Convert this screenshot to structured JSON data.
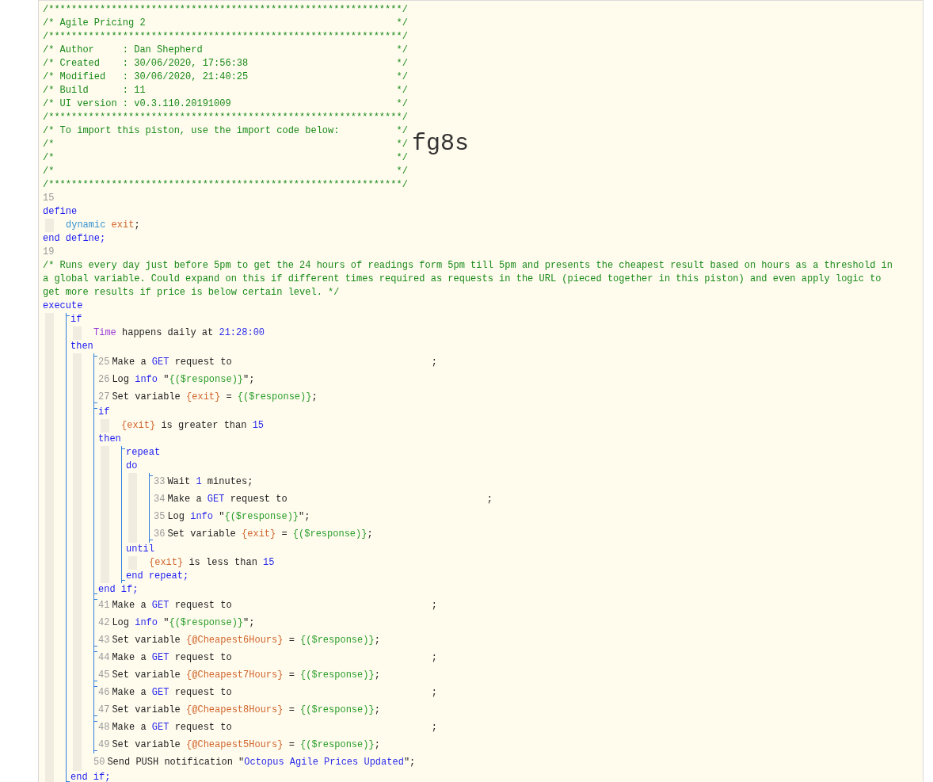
{
  "header": [
    {
      "text": "/**************************************************************/"
    },
    {
      "text": "/* Agile Pricing 2",
      "close": "*/"
    },
    {
      "text": "/**************************************************************/"
    },
    {
      "text": "/* Author     : Dan Shepherd",
      "close": "*/"
    },
    {
      "text": "/* Created    : 30/06/2020, 17:56:38",
      "close": "*/"
    },
    {
      "text": "/* Modified   : 30/06/2020, 21:40:25",
      "close": "*/"
    },
    {
      "text": "/* Build      : 11",
      "close": "*/"
    },
    {
      "text": "/* UI version : v0.3.110.20191009",
      "close": "*/"
    },
    {
      "text": "/**************************************************************/"
    },
    {
      "text": "/* To import this piston, use the import code below:",
      "close": "*/"
    },
    {
      "text": "/*",
      "close": "*/",
      "import_code": "fg8s"
    },
    {
      "text": "/*",
      "close": "*/"
    },
    {
      "text": "/*",
      "close": "*/"
    },
    {
      "text": "/**************************************************************/"
    }
  ],
  "code": [
    {
      "kind": "line",
      "number": "15"
    },
    {
      "kind": "line",
      "tokens": [
        {
          "text": "define",
          "kind": "keyword"
        }
      ]
    },
    {
      "kind": "indent",
      "children": [
        {
          "kind": "line",
          "tokens": [
            {
              "text": "dynamic ",
              "kind": "type"
            },
            {
              "text": "exit",
              "kind": "variable"
            },
            {
              "text": ";",
              "kind": "plain"
            }
          ]
        }
      ]
    },
    {
      "kind": "line",
      "tokens": [
        {
          "text": "end define;",
          "kind": "keyword"
        }
      ]
    },
    {
      "kind": "line",
      "number": "19"
    },
    {
      "kind": "comment",
      "text": "/* Runs every day just before 5pm to get the 24 hours of readings form 5pm till 5pm and presents the cheapest result based on hours as a threshold in a global variable. Could expand on this if different times required as requests in the URL (pieced together in this piston) and even apply logic to get more results if price is below certain level. */"
    },
    {
      "kind": "line",
      "tokens": [
        {
          "text": "execute",
          "kind": "keyword"
        }
      ]
    },
    {
      "kind": "indent",
      "children": [
        {
          "kind": "bracket",
          "children": [
            {
              "kind": "line",
              "tokens": [
                {
                  "text": "if",
                  "kind": "keyword"
                }
              ]
            },
            {
              "kind": "indent",
              "children": [
                {
                  "kind": "line",
                  "tokens": [
                    {
                      "text": "Time",
                      "kind": "device"
                    },
                    {
                      "text": " happens daily at ",
                      "kind": "plain"
                    },
                    {
                      "text": "21:28:00",
                      "kind": "value"
                    }
                  ]
                }
              ]
            },
            {
              "kind": "line",
              "tokens": [
                {
                  "text": "then",
                  "kind": "keyword"
                }
              ]
            },
            {
              "kind": "indent",
              "children": [
                {
                  "kind": "bracket",
                  "children": [
                    {
                      "kind": "line",
                      "number": "25",
                      "tokens": [
                        {
                          "text": "Make a ",
                          "kind": "plain"
                        },
                        {
                          "text": "GET",
                          "kind": "value"
                        },
                        {
                          "text": " request to",
                          "kind": "plain"
                        },
                        {
                          "text": ";",
                          "kind": "terminator"
                        }
                      ]
                    },
                    {
                      "kind": "line",
                      "number": "26",
                      "tokens": [
                        {
                          "text": "Log ",
                          "kind": "plain"
                        },
                        {
                          "text": "info",
                          "kind": "value"
                        },
                        {
                          "text": " \"",
                          "kind": "plain"
                        },
                        {
                          "text": "{($response)}",
                          "kind": "string"
                        },
                        {
                          "text": "\";",
                          "kind": "plain"
                        }
                      ]
                    },
                    {
                      "kind": "line",
                      "number": "27",
                      "tokens": [
                        {
                          "text": "Set variable ",
                          "kind": "plain"
                        },
                        {
                          "text": "{exit}",
                          "kind": "variable"
                        },
                        {
                          "text": " = ",
                          "kind": "plain"
                        },
                        {
                          "text": "{($response)}",
                          "kind": "string"
                        },
                        {
                          "text": ";",
                          "kind": "plain"
                        }
                      ]
                    }
                  ]
                },
                {
                  "kind": "bracket",
                  "children": [
                    {
                      "kind": "line",
                      "tokens": [
                        {
                          "text": "if",
                          "kind": "keyword"
                        }
                      ]
                    },
                    {
                      "kind": "indent",
                      "children": [
                        {
                          "kind": "line",
                          "tokens": [
                            {
                              "text": "{exit}",
                              "kind": "variable"
                            },
                            {
                              "text": " is greater than ",
                              "kind": "plain"
                            },
                            {
                              "text": "15",
                              "kind": "value"
                            }
                          ]
                        }
                      ]
                    },
                    {
                      "kind": "line",
                      "tokens": [
                        {
                          "text": "then",
                          "kind": "keyword"
                        }
                      ]
                    },
                    {
                      "kind": "indent",
                      "children": [
                        {
                          "kind": "bracket",
                          "children": [
                            {
                              "kind": "line",
                              "tokens": [
                                {
                                  "text": "repeat",
                                  "kind": "keyword"
                                }
                              ]
                            },
                            {
                              "kind": "line",
                              "tokens": [
                                {
                                  "text": "do",
                                  "kind": "keyword"
                                }
                              ]
                            },
                            {
                              "kind": "indent",
                              "children": [
                                {
                                  "kind": "bracket",
                                  "children": [
                                    {
                                      "kind": "line",
                                      "number": "33",
                                      "tokens": [
                                        {
                                          "text": "Wait ",
                                          "kind": "plain"
                                        },
                                        {
                                          "text": "1",
                                          "kind": "value"
                                        },
                                        {
                                          "text": " minutes;",
                                          "kind": "plain"
                                        }
                                      ]
                                    },
                                    {
                                      "kind": "line",
                                      "number": "34",
                                      "tokens": [
                                        {
                                          "text": "Make a ",
                                          "kind": "plain"
                                        },
                                        {
                                          "text": "GET",
                                          "kind": "value"
                                        },
                                        {
                                          "text": " request to",
                                          "kind": "plain"
                                        },
                                        {
                                          "text": ";",
                                          "kind": "terminator"
                                        }
                                      ]
                                    },
                                    {
                                      "kind": "line",
                                      "number": "35",
                                      "tokens": [
                                        {
                                          "text": "Log ",
                                          "kind": "plain"
                                        },
                                        {
                                          "text": "info",
                                          "kind": "value"
                                        },
                                        {
                                          "text": " \"",
                                          "kind": "plain"
                                        },
                                        {
                                          "text": "{($response)}",
                                          "kind": "string"
                                        },
                                        {
                                          "text": "\";",
                                          "kind": "plain"
                                        }
                                      ]
                                    },
                                    {
                                      "kind": "line",
                                      "number": "36",
                                      "tokens": [
                                        {
                                          "text": "Set variable ",
                                          "kind": "plain"
                                        },
                                        {
                                          "text": "{exit}",
                                          "kind": "variable"
                                        },
                                        {
                                          "text": " = ",
                                          "kind": "plain"
                                        },
                                        {
                                          "text": "{($response)}",
                                          "kind": "string"
                                        },
                                        {
                                          "text": ";",
                                          "kind": "plain"
                                        }
                                      ]
                                    }
                                  ]
                                }
                              ]
                            },
                            {
                              "kind": "line",
                              "tokens": [
                                {
                                  "text": "until",
                                  "kind": "keyword"
                                }
                              ]
                            },
                            {
                              "kind": "indent",
                              "children": [
                                {
                                  "kind": "line",
                                  "tokens": [
                                    {
                                      "text": "{exit}",
                                      "kind": "variable"
                                    },
                                    {
                                      "text": " is less than ",
                                      "kind": "plain"
                                    },
                                    {
                                      "text": "15",
                                      "kind": "value"
                                    }
                                  ]
                                }
                              ]
                            },
                            {
                              "kind": "line",
                              "tokens": [
                                {
                                  "text": "end repeat;",
                                  "kind": "keyword"
                                }
                              ]
                            }
                          ]
                        }
                      ]
                    },
                    {
                      "kind": "line",
                      "tokens": [
                        {
                          "text": "end if;",
                          "kind": "keyword"
                        }
                      ]
                    }
                  ]
                },
                {
                  "kind": "bracket",
                  "children": [
                    {
                      "kind": "line",
                      "number": "41",
                      "tokens": [
                        {
                          "text": "Make a ",
                          "kind": "plain"
                        },
                        {
                          "text": "GET",
                          "kind": "value"
                        },
                        {
                          "text": " request to",
                          "kind": "plain"
                        },
                        {
                          "text": ";",
                          "kind": "terminator"
                        }
                      ]
                    },
                    {
                      "kind": "line",
                      "number": "42",
                      "tokens": [
                        {
                          "text": "Log ",
                          "kind": "plain"
                        },
                        {
                          "text": "info",
                          "kind": "value"
                        },
                        {
                          "text": " \"",
                          "kind": "plain"
                        },
                        {
                          "text": "{($response)}",
                          "kind": "string"
                        },
                        {
                          "text": "\";",
                          "kind": "plain"
                        }
                      ]
                    },
                    {
                      "kind": "line",
                      "number": "43",
                      "tokens": [
                        {
                          "text": "Set variable ",
                          "kind": "plain"
                        },
                        {
                          "text": "{@Cheapest6Hours}",
                          "kind": "variable"
                        },
                        {
                          "text": " = ",
                          "kind": "plain"
                        },
                        {
                          "text": "{($response)}",
                          "kind": "string"
                        },
                        {
                          "text": ";",
                          "kind": "plain"
                        }
                      ]
                    }
                  ]
                },
                {
                  "kind": "bracket",
                  "children": [
                    {
                      "kind": "line",
                      "number": "44",
                      "tokens": [
                        {
                          "text": "Make a ",
                          "kind": "plain"
                        },
                        {
                          "text": "GET",
                          "kind": "value"
                        },
                        {
                          "text": " request to",
                          "kind": "plain"
                        },
                        {
                          "text": ";",
                          "kind": "terminator"
                        }
                      ]
                    },
                    {
                      "kind": "line",
                      "number": "45",
                      "tokens": [
                        {
                          "text": "Set variable ",
                          "kind": "plain"
                        },
                        {
                          "text": "{@Cheapest7Hours}",
                          "kind": "variable"
                        },
                        {
                          "text": " = ",
                          "kind": "plain"
                        },
                        {
                          "text": "{($response)}",
                          "kind": "string"
                        },
                        {
                          "text": ";",
                          "kind": "plain"
                        }
                      ]
                    }
                  ]
                },
                {
                  "kind": "bracket",
                  "children": [
                    {
                      "kind": "line",
                      "number": "46",
                      "tokens": [
                        {
                          "text": "Make a ",
                          "kind": "plain"
                        },
                        {
                          "text": "GET",
                          "kind": "value"
                        },
                        {
                          "text": " request to",
                          "kind": "plain"
                        },
                        {
                          "text": ";",
                          "kind": "terminator"
                        }
                      ]
                    },
                    {
                      "kind": "line",
                      "number": "47",
                      "tokens": [
                        {
                          "text": "Set variable ",
                          "kind": "plain"
                        },
                        {
                          "text": "{@Cheapest8Hours}",
                          "kind": "variable"
                        },
                        {
                          "text": " = ",
                          "kind": "plain"
                        },
                        {
                          "text": "{($response)}",
                          "kind": "string"
                        },
                        {
                          "text": ";",
                          "kind": "plain"
                        }
                      ]
                    }
                  ]
                },
                {
                  "kind": "bracket",
                  "children": [
                    {
                      "kind": "line",
                      "number": "48",
                      "tokens": [
                        {
                          "text": "Make a ",
                          "kind": "plain"
                        },
                        {
                          "text": "GET",
                          "kind": "value"
                        },
                        {
                          "text": " request to",
                          "kind": "plain"
                        },
                        {
                          "text": ";",
                          "kind": "terminator"
                        }
                      ]
                    },
                    {
                      "kind": "line",
                      "number": "49",
                      "tokens": [
                        {
                          "text": "Set variable ",
                          "kind": "plain"
                        },
                        {
                          "text": "{@Cheapest5Hours}",
                          "kind": "variable"
                        },
                        {
                          "text": " = ",
                          "kind": "plain"
                        },
                        {
                          "text": "{($response)}",
                          "kind": "string"
                        },
                        {
                          "text": ";",
                          "kind": "plain"
                        }
                      ]
                    }
                  ]
                },
                {
                  "kind": "line",
                  "number": "50",
                  "tokens": [
                    {
                      "text": "Send PUSH notification \"",
                      "kind": "plain"
                    },
                    {
                      "text": "Octopus Agile Prices Updated",
                      "kind": "value"
                    },
                    {
                      "text": "\";",
                      "kind": "plain"
                    }
                  ]
                }
              ]
            },
            {
              "kind": "line",
              "tokens": [
                {
                  "text": "end if;",
                  "kind": "keyword"
                }
              ]
            }
          ]
        }
      ]
    }
  ]
}
